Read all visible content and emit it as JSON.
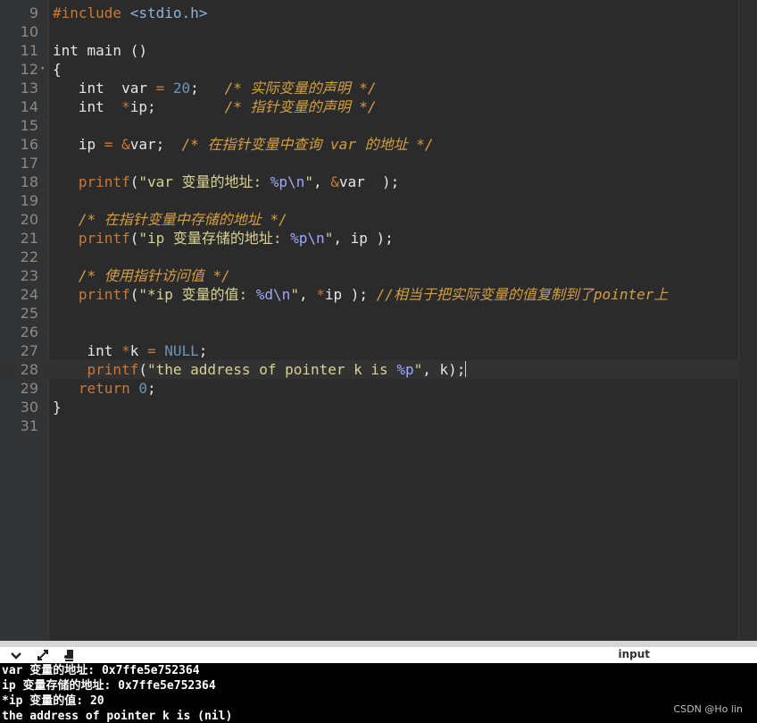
{
  "editor": {
    "lines": [
      {
        "n": "9",
        "tokens": [
          [
            "pp",
            "#include "
          ],
          [
            "inc",
            "<stdio.h>"
          ]
        ]
      },
      {
        "n": "10",
        "tokens": []
      },
      {
        "n": "11",
        "tokens": [
          [
            "kw",
            "int main ()"
          ]
        ]
      },
      {
        "n": "12",
        "fold": "▾",
        "tokens": [
          [
            "kw",
            "{"
          ]
        ]
      },
      {
        "n": "13",
        "tokens": [
          [
            "kw",
            "   int  var "
          ],
          [
            "op",
            "="
          ],
          [
            "kw",
            " "
          ],
          [
            "num",
            "20"
          ],
          [
            "kw",
            ";   "
          ],
          [
            "cm",
            "/* 实际变量的声明 */"
          ]
        ]
      },
      {
        "n": "14",
        "tokens": [
          [
            "kw",
            "   int  "
          ],
          [
            "op",
            "*"
          ],
          [
            "kw",
            "ip;        "
          ],
          [
            "cm",
            "/* 指针变量的声明 */"
          ]
        ]
      },
      {
        "n": "15",
        "tokens": []
      },
      {
        "n": "16",
        "tokens": [
          [
            "kw",
            "   ip "
          ],
          [
            "op",
            "="
          ],
          [
            "kw",
            " "
          ],
          [
            "op",
            "&"
          ],
          [
            "kw",
            "var;  "
          ],
          [
            "cm",
            "/* 在指针变量中查询 var 的地址 */"
          ]
        ]
      },
      {
        "n": "17",
        "tokens": []
      },
      {
        "n": "18",
        "tokens": [
          [
            "kw",
            "   "
          ],
          [
            "fn",
            "printf"
          ],
          [
            "kw",
            "("
          ],
          [
            "str",
            "\"var 变量的地址: "
          ],
          [
            "fmt",
            "%p\\n"
          ],
          [
            "str",
            "\""
          ],
          [
            "kw",
            ", "
          ],
          [
            "op",
            "&"
          ],
          [
            "kw",
            "var  );"
          ]
        ]
      },
      {
        "n": "19",
        "tokens": []
      },
      {
        "n": "20",
        "tokens": [
          [
            "kw",
            "   "
          ],
          [
            "cm",
            "/* 在指针变量中存储的地址 */"
          ]
        ]
      },
      {
        "n": "21",
        "tokens": [
          [
            "kw",
            "   "
          ],
          [
            "fn",
            "printf"
          ],
          [
            "kw",
            "("
          ],
          [
            "str",
            "\"ip 变量存储的地址: "
          ],
          [
            "fmt",
            "%p\\n"
          ],
          [
            "str",
            "\""
          ],
          [
            "kw",
            ", ip );"
          ]
        ]
      },
      {
        "n": "22",
        "tokens": []
      },
      {
        "n": "23",
        "tokens": [
          [
            "kw",
            "   "
          ],
          [
            "cm",
            "/* 使用指针访问值 */"
          ]
        ]
      },
      {
        "n": "24",
        "tokens": [
          [
            "kw",
            "   "
          ],
          [
            "fn",
            "printf"
          ],
          [
            "kw",
            "("
          ],
          [
            "str",
            "\"*ip 变量的值: "
          ],
          [
            "fmt",
            "%d\\n"
          ],
          [
            "str",
            "\""
          ],
          [
            "kw",
            ", "
          ],
          [
            "op",
            "*"
          ],
          [
            "kw",
            "ip ); "
          ],
          [
            "cm",
            "//相当于把实际变量的值复制到了pointer上"
          ]
        ]
      },
      {
        "n": "25",
        "tokens": []
      },
      {
        "n": "26",
        "tokens": []
      },
      {
        "n": "27",
        "tokens": [
          [
            "kw",
            "    int "
          ],
          [
            "op",
            "*"
          ],
          [
            "kw",
            "k "
          ],
          [
            "op",
            "="
          ],
          [
            "kw",
            " "
          ],
          [
            "null",
            "NULL"
          ],
          [
            "kw",
            ";"
          ]
        ]
      },
      {
        "n": "28",
        "current": true,
        "tokens": [
          [
            "kw",
            "    "
          ],
          [
            "fn",
            "printf"
          ],
          [
            "kw",
            "("
          ],
          [
            "str",
            "\"the address of pointer k is "
          ],
          [
            "fmt",
            "%p"
          ],
          [
            "str",
            "\""
          ],
          [
            "kw",
            ", k);"
          ]
        ]
      },
      {
        "n": "29",
        "tokens": [
          [
            "kw",
            "   "
          ],
          [
            "op",
            "return"
          ],
          [
            "kw",
            " "
          ],
          [
            "num",
            "0"
          ],
          [
            "kw",
            ";"
          ]
        ]
      },
      {
        "n": "30",
        "tokens": [
          [
            "kw",
            "}"
          ]
        ]
      },
      {
        "n": "31",
        "tokens": []
      }
    ]
  },
  "console": {
    "title": "input",
    "icons": [
      "chevron-down-icon",
      "expand-arrows-icon",
      "clear-icon"
    ],
    "output": [
      "var 变量的地址: 0x7ffe5e752364",
      "ip 变量存储的地址: 0x7ffe5e752364",
      "*ip 变量的值: 20",
      "the address of pointer k is (nil)"
    ]
  },
  "watermark": "CSDN @Ho lin"
}
